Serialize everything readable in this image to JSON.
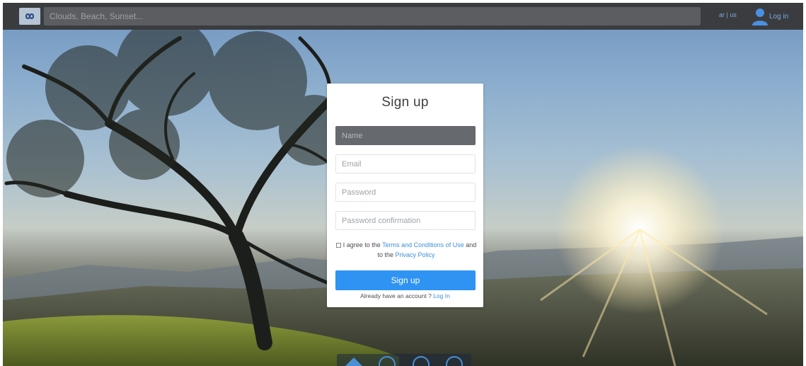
{
  "topbar": {
    "search_placeholder": "Clouds, Beach, Sunset...",
    "lang_label": "ar | us",
    "login_label": "Log in"
  },
  "form": {
    "title": "Sign up",
    "name_placeholder": "Name",
    "email_placeholder": "Email",
    "password_placeholder": "Password",
    "password_confirm_placeholder": "Password confirmation",
    "agree_prefix": "I agree to the",
    "terms_link": "Terms and Conditions of Use",
    "agree_middle": "and to the",
    "privacy_link": "Privacy Policy",
    "submit_label": "Sign up",
    "already_text": "Already have an account ?",
    "login_link": "Log In"
  },
  "bottom_nav": {
    "icons": [
      "home-icon",
      "explore-icon",
      "mail-icon",
      "chat-icon"
    ]
  },
  "colors": {
    "accent": "#2e93f2",
    "topbar": "#3a3c3f",
    "link": "#3d8fd8"
  }
}
